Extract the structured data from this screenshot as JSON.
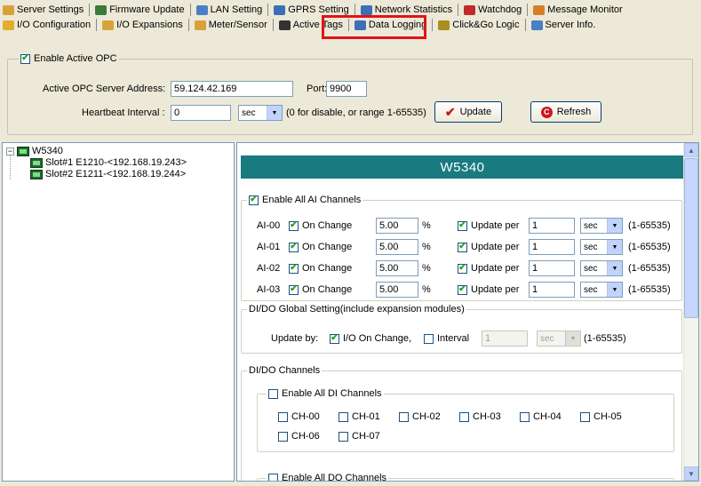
{
  "tabs_row1": [
    {
      "label": "Server Settings",
      "icon": "server-settings-icon",
      "color": "#d8a23a"
    },
    {
      "label": "Firmware Update",
      "icon": "firmware-update-icon",
      "color": "#3a7a3a"
    },
    {
      "label": "LAN Setting",
      "icon": "lan-setting-icon",
      "color": "#4a7fc8"
    },
    {
      "label": "GPRS Setting",
      "icon": "gprs-setting-icon",
      "color": "#3b6fb6"
    },
    {
      "label": "Network Statistics",
      "icon": "network-statistics-icon",
      "color": "#3b6fb6"
    },
    {
      "label": "Watchdog",
      "icon": "watchdog-icon",
      "color": "#c22a2a"
    },
    {
      "label": "Message Monitor",
      "icon": "message-monitor-icon",
      "color": "#d77d2a"
    }
  ],
  "tabs_row2": [
    {
      "label": "I/O Configuration",
      "icon": "io-configuration-icon",
      "color": "#e0b02a"
    },
    {
      "label": "I/O Expansions",
      "icon": "io-expansions-icon",
      "color": "#d8a23a"
    },
    {
      "label": "Meter/Sensor",
      "icon": "meter-sensor-icon",
      "color": "#d8a23a"
    },
    {
      "label": "Active Tags",
      "icon": "active-tags-icon",
      "color": "#333333"
    },
    {
      "label": "Data Logging",
      "icon": "data-logging-icon",
      "color": "#3b6fb6"
    },
    {
      "label": "Click&Go Logic",
      "icon": "click-go-logic-icon",
      "color": "#a89020"
    },
    {
      "label": "Server Info.",
      "icon": "server-info-icon",
      "color": "#4a7fc8"
    }
  ],
  "opc": {
    "enable_label": "Enable Active OPC",
    "enabled": true,
    "address_label": "Active OPC Server Address:",
    "address_value": "59.124.42.169",
    "port_label": "Port:",
    "port_value": "9900",
    "heartbeat_label": "Heartbeat Interval :",
    "heartbeat_value": "0",
    "heartbeat_unit": "sec",
    "heartbeat_hint": "(0 for disable, or range 1-65535)",
    "update_button": "Update",
    "refresh_button": "Refresh"
  },
  "tree": {
    "root": "W5340",
    "children": [
      "Slot#1 E1210-<192.168.19.243>",
      "Slot#2 E1211-<192.168.19.244>"
    ]
  },
  "detail": {
    "header": "W5340",
    "ai_group_label": "Enable All AI Channels",
    "ai_channels": [
      {
        "name": "AI-00",
        "on_change": "On Change",
        "value": "5.00",
        "unit": "%",
        "update_label": "Update per",
        "interval": "1",
        "interval_unit": "sec",
        "range": "(1-65535)"
      },
      {
        "name": "AI-01",
        "on_change": "On Change",
        "value": "5.00",
        "unit": "%",
        "update_label": "Update per",
        "interval": "1",
        "interval_unit": "sec",
        "range": "(1-65535)"
      },
      {
        "name": "AI-02",
        "on_change": "On Change",
        "value": "5.00",
        "unit": "%",
        "update_label": "Update per",
        "interval": "1",
        "interval_unit": "sec",
        "range": "(1-65535)"
      },
      {
        "name": "AI-03",
        "on_change": "On Change",
        "value": "5.00",
        "unit": "%",
        "update_label": "Update per",
        "interval": "1",
        "interval_unit": "sec",
        "range": "(1-65535)"
      }
    ],
    "dido_global_label": "DI/DO Global Setting(include expansion modules)",
    "update_by_label": "Update by:",
    "io_on_change_label": "I/O On Change,",
    "interval_label": "Interval",
    "interval_value": "1",
    "interval_unit": "sec",
    "interval_range": "(1-65535)",
    "dido_channels_label": "DI/DO Channels",
    "enable_all_di": "Enable All DI Channels",
    "di_channels": [
      "CH-00",
      "CH-01",
      "CH-02",
      "CH-03",
      "CH-04",
      "CH-05",
      "CH-06",
      "CH-07"
    ],
    "enable_all_do": "Enable All DO Channels"
  }
}
